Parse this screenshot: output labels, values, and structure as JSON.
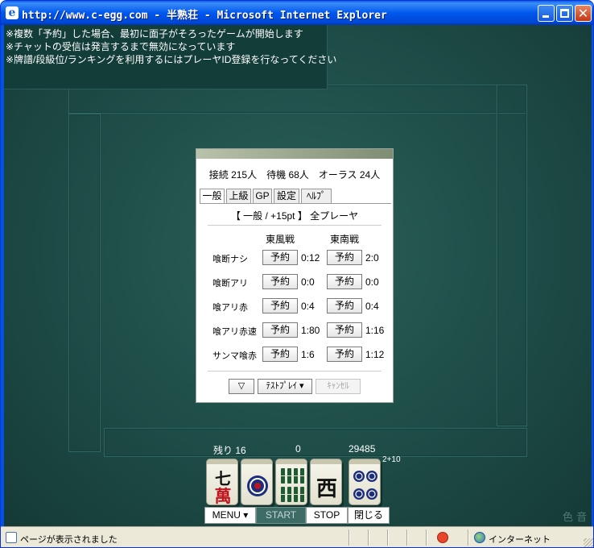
{
  "window": {
    "title": "http://www.c-egg.com - 半熟荘 - Microsoft Internet Explorer"
  },
  "notice": {
    "lines": [
      "※複数「予約」した場合、最初に面子がそろったゲームが開始します",
      "※チャットの受信は発言するまで無効になっています",
      "※牌譜/段級位/ランキングを利用するにはプレーヤID登録を行なってください"
    ]
  },
  "lobby": {
    "connections": "接続 215人　待機 68人　オーラス 24人",
    "tabs": [
      {
        "label": "一般",
        "active": true
      },
      {
        "label": "上級",
        "active": false
      },
      {
        "label": "GP",
        "active": false
      },
      {
        "label": "設定",
        "active": false
      },
      {
        "label": "ﾍﾙﾌﾟ",
        "active": false
      }
    ],
    "mode": "【 一般 / +15pt 】 全プレーヤ",
    "columns": [
      "東風戦",
      "東南戦"
    ],
    "reserve_label": "予約",
    "rows": [
      {
        "label": "喰断ナシ",
        "tonpu": "0:12",
        "tonnan": "2:0"
      },
      {
        "label": "喰断アリ",
        "tonpu": "0:0",
        "tonnan": "0:0"
      },
      {
        "label": "喰アリ赤",
        "tonpu": "0:4",
        "tonnan": "0:4"
      },
      {
        "label": "喰アリ赤速",
        "tonpu": "1:80",
        "tonnan": "1:16"
      },
      {
        "label": "サンマ喰赤",
        "tonpu": "1:6",
        "tonnan": "1:12"
      }
    ],
    "controls": {
      "down_label": "▽",
      "testplay_label": "ﾃｽﾄﾌﾟﾚｲ ▾",
      "cancel_label": "ｷｬﾝｾﾙ"
    }
  },
  "game": {
    "remaining": "残り 16",
    "center_value": "0",
    "score": "29485",
    "bonus": "2+10",
    "tiles": [
      {
        "name": "seven-man-tile",
        "top": "七",
        "bottom": "萬"
      },
      {
        "name": "one-pin-tile"
      },
      {
        "name": "eight-sou-tile"
      },
      {
        "name": "west-tile",
        "kanji": "西"
      },
      {
        "name": "four-pin-tile"
      }
    ],
    "buttons": {
      "menu": "MENU ▾",
      "start": "START",
      "stop": "STOP",
      "close": "閉じる"
    },
    "corner_text": "色 音"
  },
  "statusbar": {
    "text": "ページが表示されました",
    "zone": "インターネット"
  },
  "colors": {
    "felt": "#1e4a46",
    "title_blue": "#0058ee",
    "red_kanji": "#c0141e",
    "pin_blue": "#1e2f7a",
    "sou_green": "#1d5b32"
  }
}
